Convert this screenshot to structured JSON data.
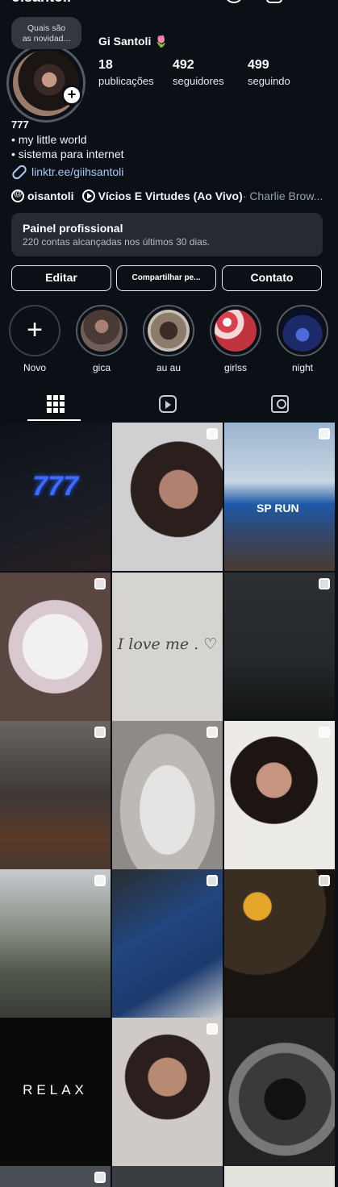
{
  "profile": {
    "handle": "oisantoli",
    "name": "Gi Santoli",
    "name_emoji": "🌷",
    "note_line1": "Quais são",
    "note_line2": "as novidad...",
    "add_label": "+",
    "stats": [
      {
        "num": "18",
        "label": "publicações"
      },
      {
        "num": "492",
        "label": "seguidores"
      },
      {
        "num": "499",
        "label": "seguindo"
      }
    ]
  },
  "bio": {
    "title": "777",
    "lines": [
      "• my little world",
      "• sistema para internet"
    ],
    "link": "linktr.ee/giihsantoli"
  },
  "meta": {
    "threads_handle": "oisantoli",
    "song": "Vícios E Virtudes (Ao Vivo)",
    "artist": " · Charlie Brow..."
  },
  "panel": {
    "title": "Painel profissional",
    "subtitle": "220 contas alcançadas nos últimos 30 dias."
  },
  "buttons": {
    "edit": "Editar",
    "share": "Compartilhar pe...",
    "contact": "Contato"
  },
  "highlights": [
    {
      "label": "Novo",
      "color": "#0b1017"
    },
    {
      "label": "gica",
      "color": "#8a6a60"
    },
    {
      "label": "au au",
      "color": "#6d5a4c"
    },
    {
      "label": "girlss",
      "color": "#c94a55"
    },
    {
      "label": "night",
      "color": "#1d2a6a"
    }
  ],
  "tabs": [
    "grid-icon",
    "reels-icon",
    "tagged-icon"
  ],
  "grid_captions": {
    "sign": "777",
    "love": "I love me . ♡",
    "relax": "RELAX",
    "sprun": "SP RUN"
  },
  "colors": {
    "background": "#0b1017",
    "panel": "#252a33",
    "link": "#a9c6f3"
  }
}
